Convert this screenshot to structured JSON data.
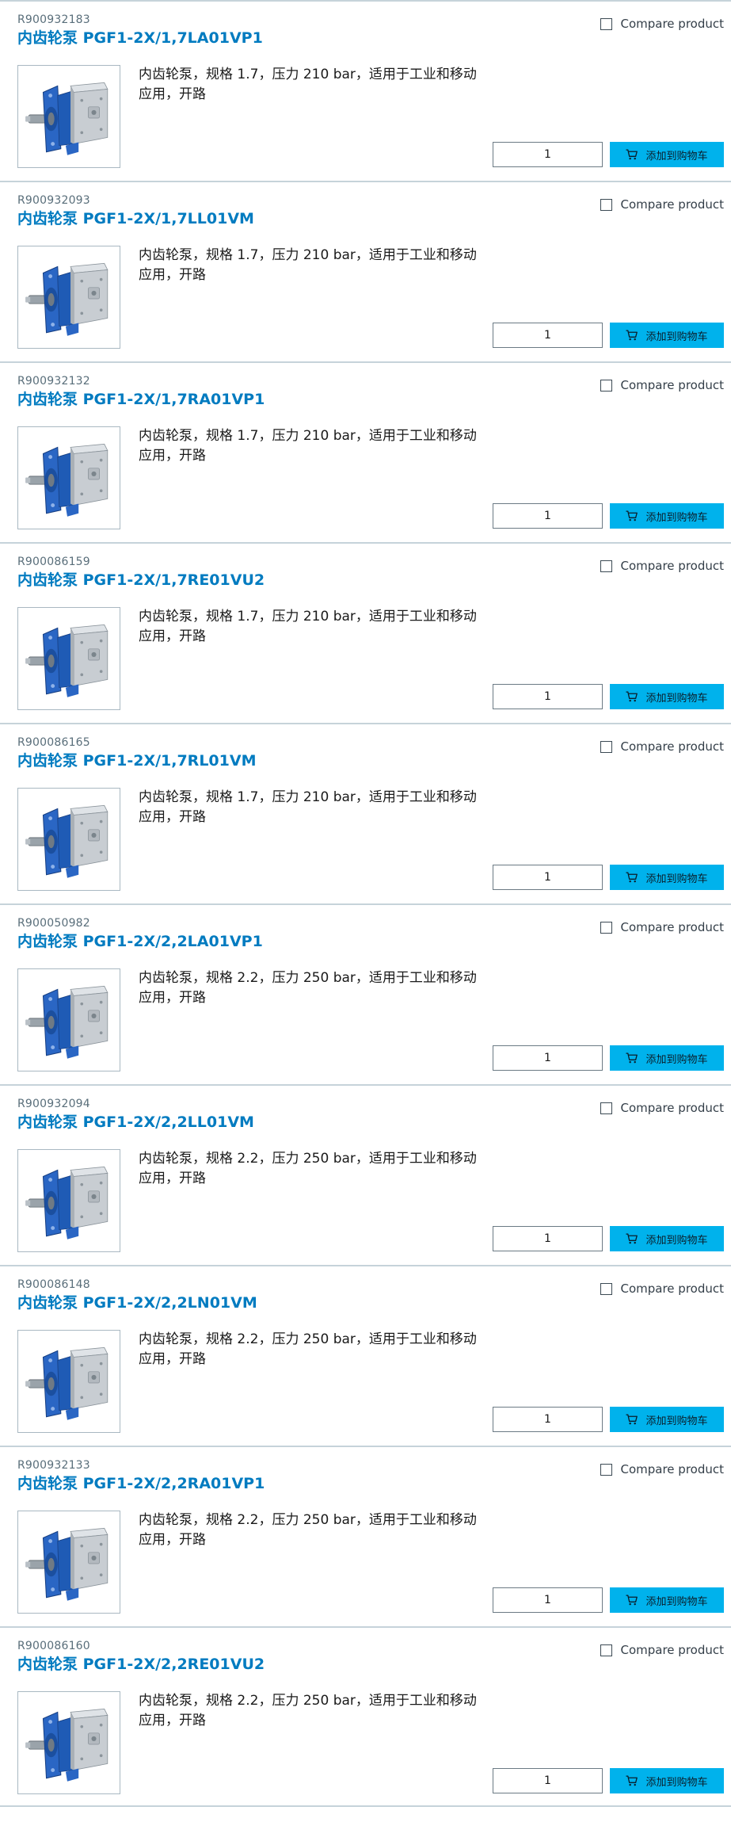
{
  "compare_label": "Compare product",
  "add_to_cart_label": "添加到购物车",
  "products": [
    {
      "part_number": "R900932183",
      "title": "内齿轮泵 PGF1-2X/1,7LA01VP1",
      "description": "内齿轮泵，规格 1.7，压力 210 bar，适用于工业和移动应用，开路",
      "quantity": "1",
      "compared": false
    },
    {
      "part_number": "R900932093",
      "title": "内齿轮泵 PGF1-2X/1,7LL01VM",
      "description": "内齿轮泵，规格 1.7，压力 210 bar，适用于工业和移动应用，开路",
      "quantity": "1",
      "compared": false
    },
    {
      "part_number": "R900932132",
      "title": "内齿轮泵 PGF1-2X/1,7RA01VP1",
      "description": "内齿轮泵，规格 1.7，压力 210 bar，适用于工业和移动应用，开路",
      "quantity": "1",
      "compared": false
    },
    {
      "part_number": "R900086159",
      "title": "内齿轮泵 PGF1-2X/1,7RE01VU2",
      "description": "内齿轮泵，规格 1.7，压力 210 bar，适用于工业和移动应用，开路",
      "quantity": "1",
      "compared": false
    },
    {
      "part_number": "R900086165",
      "title": "内齿轮泵 PGF1-2X/1,7RL01VM",
      "description": "内齿轮泵，规格 1.7，压力 210 bar，适用于工业和移动应用，开路",
      "quantity": "1",
      "compared": false
    },
    {
      "part_number": "R900050982",
      "title": "内齿轮泵 PGF1-2X/2,2LA01VP1",
      "description": "内齿轮泵，规格 2.2，压力 250 bar，适用于工业和移动应用，开路",
      "quantity": "1",
      "compared": false
    },
    {
      "part_number": "R900932094",
      "title": "内齿轮泵 PGF1-2X/2,2LL01VM",
      "description": "内齿轮泵，规格 2.2，压力 250 bar，适用于工业和移动应用，开路",
      "quantity": "1",
      "compared": false
    },
    {
      "part_number": "R900086148",
      "title": "内齿轮泵 PGF1-2X/2,2LN01VM",
      "description": "内齿轮泵，规格 2.2，压力 250 bar，适用于工业和移动应用，开路",
      "quantity": "1",
      "compared": false
    },
    {
      "part_number": "R900932133",
      "title": "内齿轮泵 PGF1-2X/2,2RA01VP1",
      "description": "内齿轮泵，规格 2.2，压力 250 bar，适用于工业和移动应用，开路",
      "quantity": "1",
      "compared": false
    },
    {
      "part_number": "R900086160",
      "title": "内齿轮泵 PGF1-2X/2,2RE01VU2",
      "description": "内齿轮泵，规格 2.2，压力 250 bar，适用于工业和移动应用，开路",
      "quantity": "1",
      "compared": false
    }
  ],
  "icons": {
    "compare": "checkbox-icon",
    "cart": "shopping-cart-icon",
    "product_image": "gear-pump-image"
  },
  "colors": {
    "title": "#007bc0",
    "part_number": "#596e7a",
    "cart_button": "#00b2ec",
    "divider": "#c6d3da",
    "pump_blue": "#1f5bb5",
    "pump_silver": "#c8cdd2"
  }
}
